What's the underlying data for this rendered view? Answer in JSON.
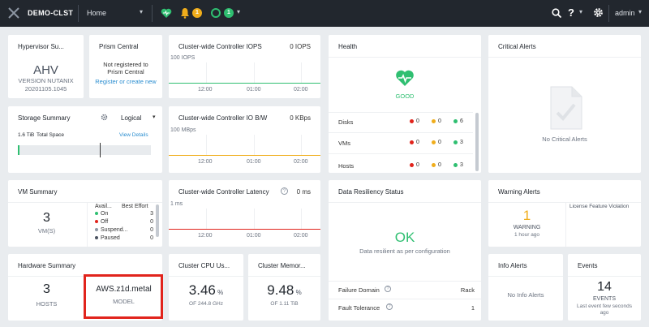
{
  "topbar": {
    "cluster_name": "DEMO-CLST",
    "view": "Home",
    "alerts_count": "1",
    "tasks_count": "1",
    "help_label": "?",
    "user": "admin"
  },
  "hypervisor": {
    "title": "Hypervisor Su...",
    "name": "AHV",
    "version_label": "VERSION NUTANIX",
    "version": "20201105.1045"
  },
  "prism_central": {
    "title": "Prism Central",
    "status_line1": "Not registered to",
    "status_line2": "Prism Central",
    "action": "Register or create new"
  },
  "iops": {
    "title": "Cluster-wide Controller IOPS",
    "value": "0 IOPS",
    "scale": "100 IOPS",
    "ticks": [
      "12:00",
      "01:00",
      "02:00"
    ]
  },
  "iobw": {
    "title": "Cluster-wide Controller IO B/W",
    "value": "0 KBps",
    "scale": "100 MBps",
    "ticks": [
      "12:00",
      "01:00",
      "02:00"
    ]
  },
  "latency": {
    "title": "Cluster-wide Controller Latency",
    "value": "0 ms",
    "scale": "1 ms",
    "ticks": [
      "12:00",
      "01:00",
      "02:00"
    ]
  },
  "health": {
    "title": "Health",
    "status": "GOOD",
    "rows": [
      {
        "label": "Disks",
        "critical": "0",
        "warning": "0",
        "good": "6"
      },
      {
        "label": "VMs",
        "critical": "0",
        "warning": "0",
        "good": "3"
      },
      {
        "label": "Hosts",
        "critical": "0",
        "warning": "0",
        "good": "3"
      }
    ]
  },
  "critical_alerts": {
    "title": "Critical Alerts",
    "empty": "No Critical Alerts"
  },
  "storage": {
    "title": "Storage Summary",
    "mode": "Logical",
    "total_value": "1.6 TiB",
    "total_label": "Total Space",
    "view_details": "View Details"
  },
  "vm_summary": {
    "title": "VM Summary",
    "count": "3",
    "count_label": "VM(S)",
    "col_a": "Avail...",
    "col_b": "Best Effort",
    "rows": [
      {
        "label": "On",
        "value": "3"
      },
      {
        "label": "Off",
        "value": "0"
      },
      {
        "label": "Suspend...",
        "value": "0"
      },
      {
        "label": "Paused",
        "value": "0"
      }
    ]
  },
  "resiliency": {
    "title": "Data Resiliency Status",
    "status": "OK",
    "message": "Data resilient as per configuration",
    "failure_domain_label": "Failure Domain",
    "failure_domain": "Rack",
    "fault_tolerance_label": "Fault Tolerance",
    "fault_tolerance": "1"
  },
  "warning_alerts": {
    "title": "Warning Alerts",
    "count": "1",
    "label": "WARNING",
    "time": "1 hour ago",
    "item": "License Feature Violation"
  },
  "hardware": {
    "title": "Hardware Summary",
    "hosts": "3",
    "hosts_label": "HOSTS",
    "model": "AWS.z1d.metal",
    "model_label": "MODEL"
  },
  "cpu": {
    "title": "Cluster CPU Us...",
    "value": "3.46",
    "unit": "%",
    "of": "OF 244.8 GHz"
  },
  "memory": {
    "title": "Cluster Memor...",
    "value": "9.48",
    "unit": "%",
    "of": "OF 1.11 TiB"
  },
  "info_alerts": {
    "title": "Info Alerts",
    "empty": "No Info Alerts"
  },
  "events": {
    "title": "Events",
    "count": "14",
    "label": "EVENTS",
    "time_line1": "Last event few seconds",
    "time_line2": "ago"
  },
  "colors": {
    "critical": "#e1241c",
    "warning": "#f0ad1b",
    "good": "#2fbf71",
    "link": "#2b8ed0"
  }
}
